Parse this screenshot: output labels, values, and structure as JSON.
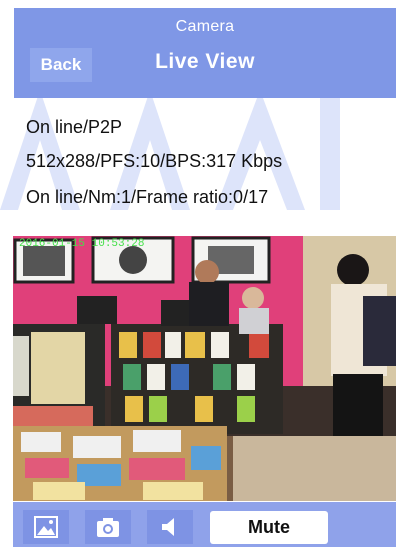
{
  "header": {
    "subtitle": "Camera",
    "title": "Live View",
    "back_label": "Back"
  },
  "status": {
    "line1": "On line/P2P",
    "line2": "512x288/PFS:10/BPS:317 Kbps",
    "line3": "On line/Nm:1/Frame ratio:0/17"
  },
  "video": {
    "timestamp": "2016-01-15 10:53:28",
    "description_icon": "camera-feed"
  },
  "toolbar": {
    "gallery_icon": "image-icon",
    "snapshot_icon": "camera-icon",
    "audio_icon": "speaker-icon",
    "mute_label": "Mute"
  },
  "colors": {
    "header_bg": "#7f97e6",
    "toolbar_bg": "#8fa2ea",
    "watermark": "#c9d3f6"
  }
}
